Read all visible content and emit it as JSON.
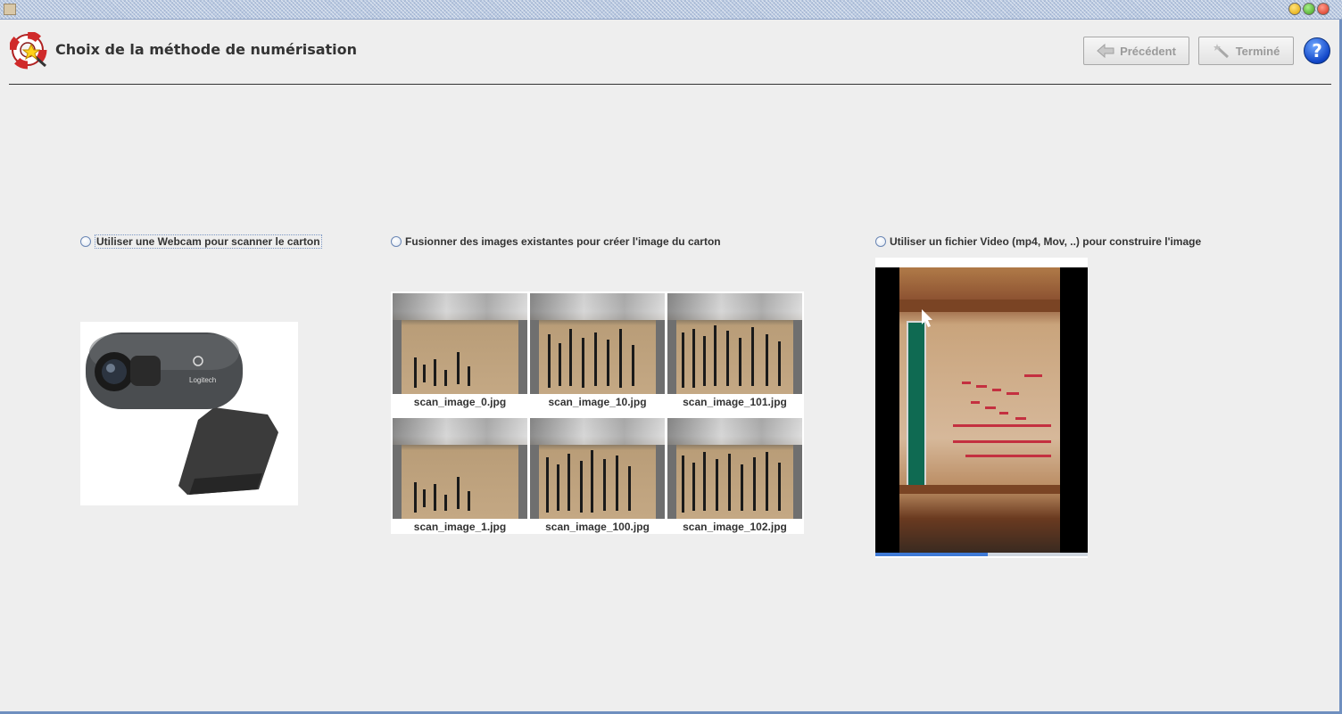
{
  "header": {
    "title": "Choix de la méthode de numérisation",
    "prev_label": "Précédent",
    "done_label": "Terminé",
    "help_label": "?"
  },
  "options": {
    "webcam_label": "Utiliser une Webcam pour scanner le carton",
    "merge_label": "Fusionner des images existantes pour créer l'image du carton",
    "video_label": "Utiliser un fichier Video (mp4, Mov, ..) pour construire l'image"
  },
  "webcam": {
    "brand": "Logitech"
  },
  "images": [
    {
      "filename": "scan_image_0.jpg"
    },
    {
      "filename": "scan_image_10.jpg"
    },
    {
      "filename": "scan_image_101.jpg"
    },
    {
      "filename": "scan_image_1.jpg"
    },
    {
      "filename": "scan_image_100.jpg"
    },
    {
      "filename": "scan_image_102.jpg"
    }
  ],
  "video": {
    "progress": 0.53
  },
  "colors": {
    "background": "#eeeeee",
    "accent": "#3f7ad6",
    "help": "#1146c8"
  }
}
